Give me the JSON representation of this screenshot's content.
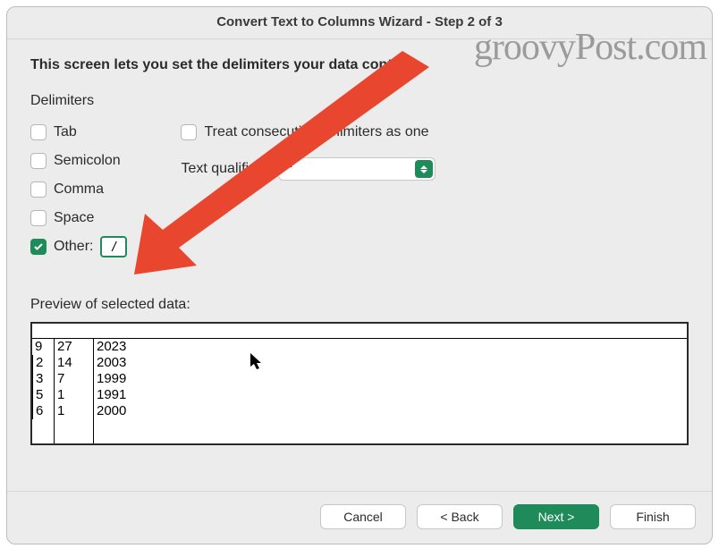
{
  "window": {
    "title": "Convert Text to Columns Wizard - Step 2 of 3"
  },
  "instruction": "This screen lets you set the delimiters your data contains.",
  "delimiters": {
    "label": "Delimiters",
    "items": [
      {
        "label": "Tab",
        "checked": false
      },
      {
        "label": "Semicolon",
        "checked": false
      },
      {
        "label": "Comma",
        "checked": false
      },
      {
        "label": "Space",
        "checked": false
      },
      {
        "label": "Other:",
        "checked": true
      }
    ],
    "other_value": "/"
  },
  "treat_consecutive": {
    "label": "Treat consecutive delimiters as one",
    "checked": false
  },
  "text_qualifier": {
    "label": "Text qualifier:",
    "value": "\""
  },
  "preview": {
    "label": "Preview of selected data:",
    "rows": [
      [
        "9",
        "27",
        "2023"
      ],
      [
        "2",
        "14",
        "2003"
      ],
      [
        "3",
        "7",
        "1999"
      ],
      [
        "5",
        "1",
        "1991"
      ],
      [
        "6",
        "1",
        "2000"
      ]
    ]
  },
  "buttons": {
    "cancel": "Cancel",
    "back": "< Back",
    "next": "Next >",
    "finish": "Finish"
  },
  "watermark": "groovyPost.com"
}
